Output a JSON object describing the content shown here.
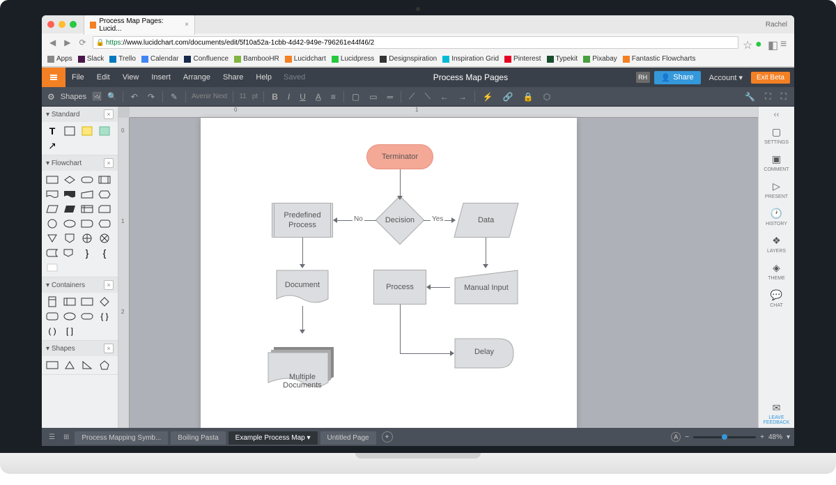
{
  "browser": {
    "tab_title": "Process Map Pages: Lucid...",
    "profile_name": "Rachel",
    "url_https": "https",
    "url_rest": "://www.lucidchart.com/documents/edit/5f10a52a-1cbb-4d42-949e-796261e44f46/2",
    "bookmarks": [
      "Apps",
      "Slack",
      "Trello",
      "Calendar",
      "Confluence",
      "BambooHR",
      "Lucidchart",
      "Lucidpress",
      "Designspiration",
      "Inspiration Grid",
      "Pinterest",
      "Typekit",
      "Pixabay",
      "Fantastic Flowcharts"
    ]
  },
  "menubar": {
    "items": [
      "File",
      "Edit",
      "View",
      "Insert",
      "Arrange",
      "Share",
      "Help"
    ],
    "saved": "Saved",
    "doc_title": "Process Map Pages",
    "avatar": "RH",
    "share": "Share",
    "account": "Account",
    "exit_beta": "Exit Beta"
  },
  "toolbar": {
    "shapes_label": "Shapes",
    "font_name": "Avenir Next",
    "font_size": "11",
    "pt": "pt"
  },
  "shapes_panel": {
    "sections": {
      "standard": "Standard",
      "flowchart": "Flowchart",
      "containers": "Containers",
      "shapes": "Shapes"
    }
  },
  "flowchart": {
    "terminator": "Terminator",
    "predefined": "Predefined\nProcess",
    "decision": "Decision",
    "data": "Data",
    "document": "Document",
    "process": "Process",
    "manual_input": "Manual Input",
    "multiple_docs": "Multiple\nDocuments",
    "delay": "Delay",
    "no": "No",
    "yes": "Yes"
  },
  "right_rail": {
    "settings": "SETTINGS",
    "comment": "COMMENT",
    "present": "PRESENT",
    "history": "HISTORY",
    "layers": "LAYERS",
    "theme": "THEME",
    "chat": "CHAT",
    "leave_feedback": "LEAVE\nFEEDBACK"
  },
  "pages": {
    "tabs": [
      "Process Mapping Symb...",
      "Boiling Pasta",
      "Example Process Map",
      "Untitled Page"
    ],
    "active_index": 2,
    "zoom": "48%"
  }
}
